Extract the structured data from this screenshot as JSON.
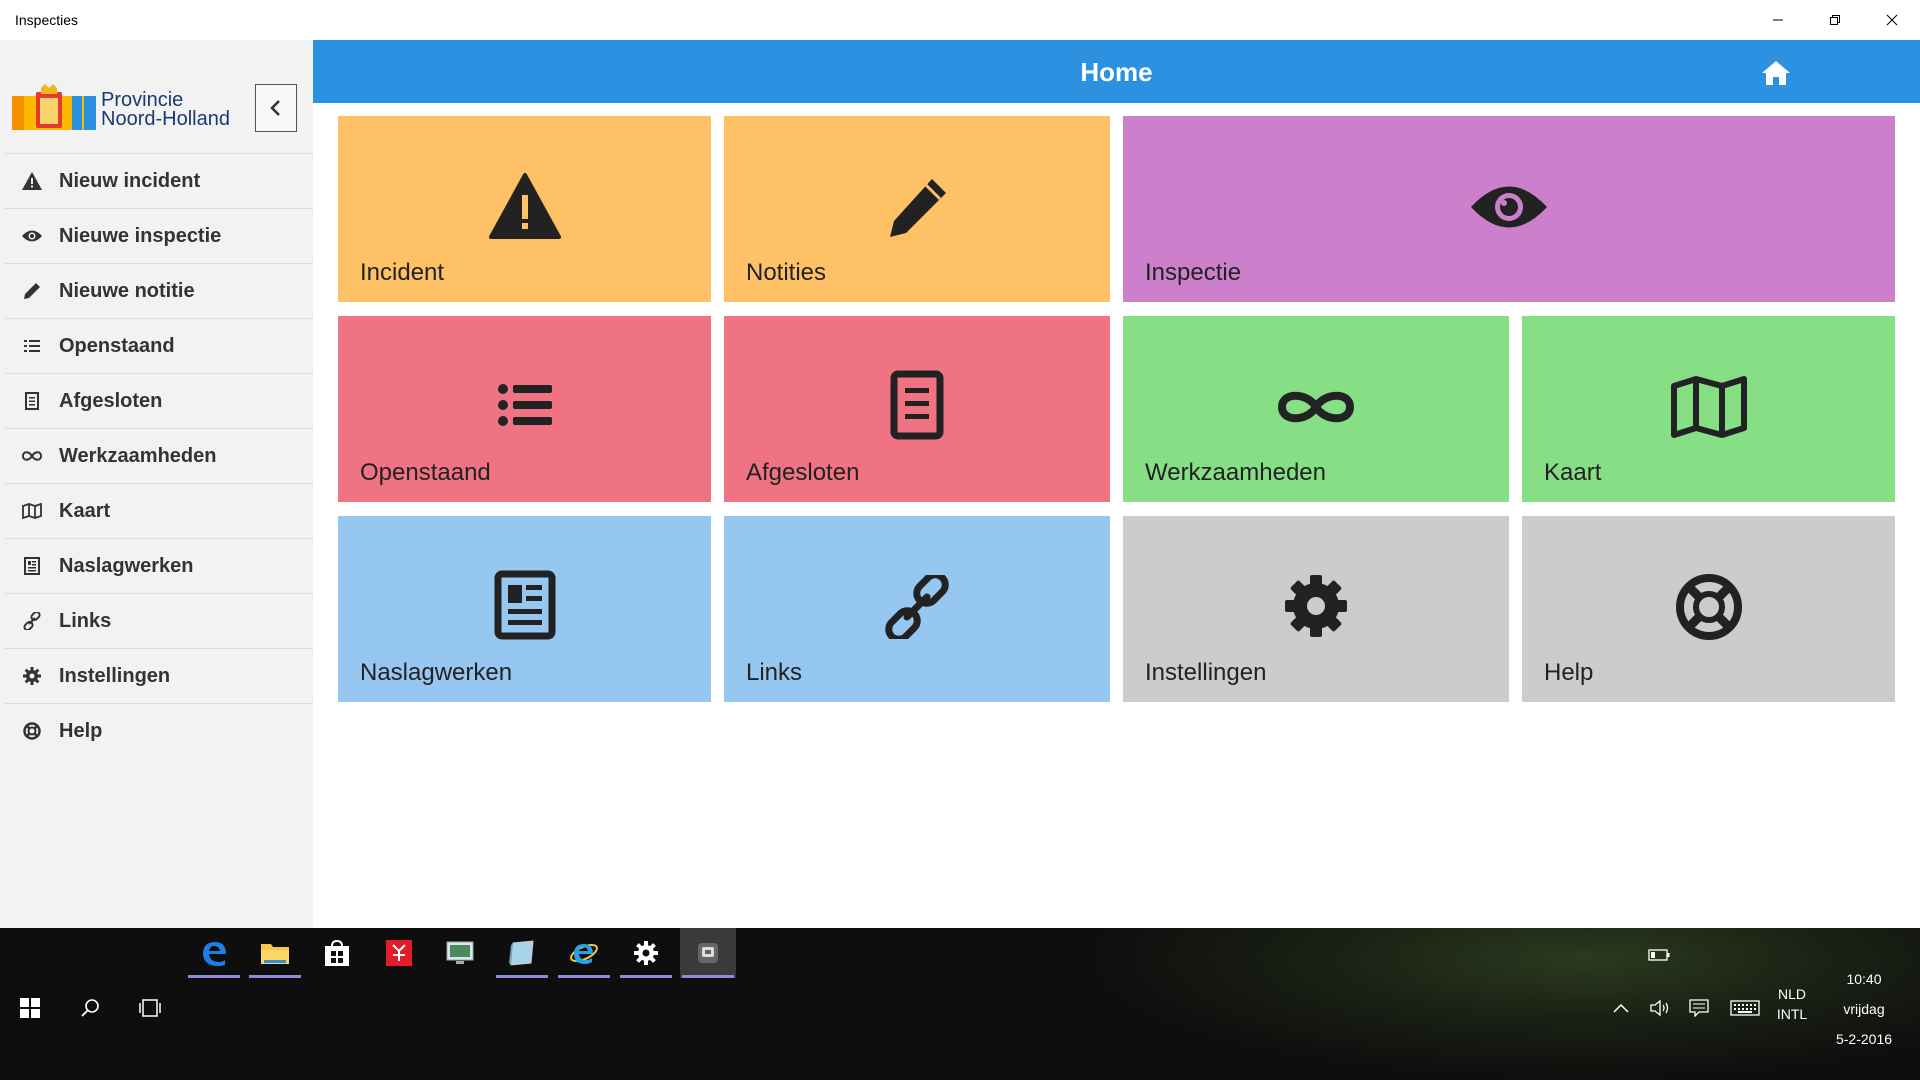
{
  "window": {
    "title": "Inspecties"
  },
  "sidebar": {
    "logo_line1": "Provincie",
    "logo_line2": "Noord-Holland",
    "items": [
      {
        "label": "Nieuw incident",
        "icon": "warning-icon"
      },
      {
        "label": "Nieuwe inspectie",
        "icon": "eye-icon"
      },
      {
        "label": "Nieuwe notitie",
        "icon": "pencil-icon"
      },
      {
        "label": "Openstaand",
        "icon": "list-icon"
      },
      {
        "label": "Afgesloten",
        "icon": "document-icon"
      },
      {
        "label": "Werkzaamheden",
        "icon": "infinity-icon"
      },
      {
        "label": "Kaart",
        "icon": "map-icon"
      },
      {
        "label": "Naslagwerken",
        "icon": "newspaper-icon"
      },
      {
        "label": "Links",
        "icon": "link-icon"
      },
      {
        "label": "Instellingen",
        "icon": "gear-icon"
      },
      {
        "label": "Help",
        "icon": "lifebuoy-icon"
      }
    ]
  },
  "header": {
    "title": "Home"
  },
  "tiles": [
    {
      "label": "Incident",
      "icon": "warning-icon",
      "color": "#fec165"
    },
    {
      "label": "Notities",
      "icon": "pencil-icon",
      "color": "#fec165"
    },
    {
      "label": "Inspectie",
      "icon": "eye-icon",
      "color": "#cc80cb"
    },
    {
      "label": "Openstaand",
      "icon": "list-icon",
      "color": "#f07384"
    },
    {
      "label": "Afgesloten",
      "icon": "document-icon",
      "color": "#f07384"
    },
    {
      "label": "Werkzaamheden",
      "icon": "infinity-icon",
      "color": "#87df85"
    },
    {
      "label": "Kaart",
      "icon": "map-icon",
      "color": "#87df85"
    },
    {
      "label": "Naslagwerken",
      "icon": "newspaper-icon",
      "color": "#96c7f0"
    },
    {
      "label": "Links",
      "icon": "link-icon",
      "color": "#96c7f0"
    },
    {
      "label": "Instellingen",
      "icon": "gear-icon",
      "color": "#cccccc"
    },
    {
      "label": "Help",
      "icon": "lifebuoy-icon",
      "color": "#cccccc"
    }
  ],
  "taskbar": {
    "language": "NLD",
    "layout": "INTL",
    "time": "10:40",
    "day": "vrijdag",
    "date": "5-2-2016"
  },
  "colors": {
    "header": "#2c91e0",
    "sidebar": "#f2f2f2",
    "taskbar": "#0e0e0e"
  }
}
